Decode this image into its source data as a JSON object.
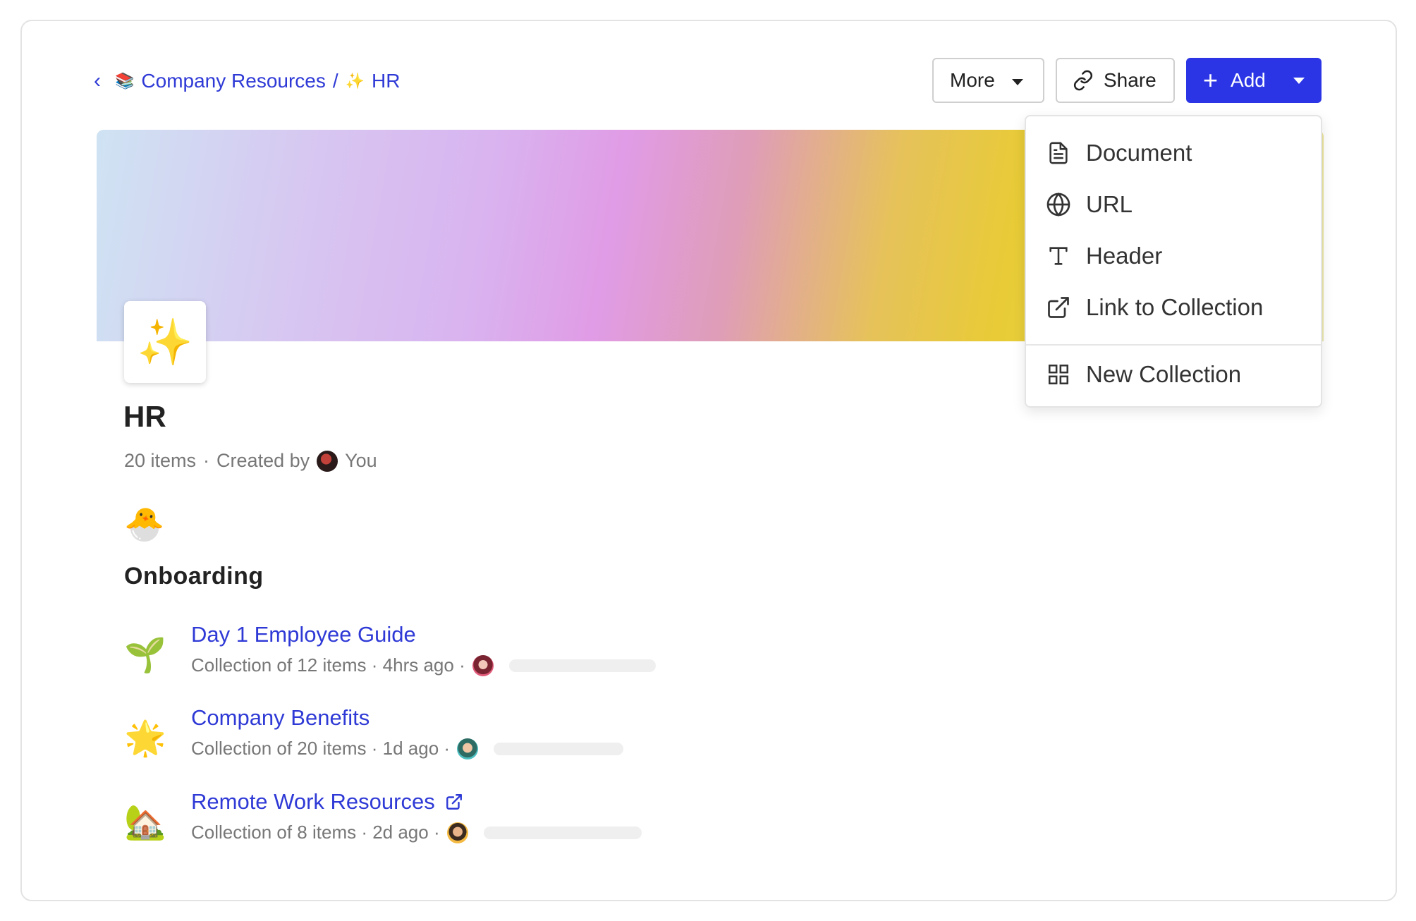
{
  "breadcrumb": {
    "back_icon": "chevron-left-icon",
    "parent_emoji": "📚",
    "parent_label": "Company Resources",
    "separator": "/",
    "current_emoji": "✨",
    "current_label": "HR"
  },
  "toolbar": {
    "more_label": "More",
    "share_label": "Share",
    "add_label": "Add",
    "add_color": "#2b35e6"
  },
  "collection": {
    "icon_emoji": "✨",
    "title": "HR",
    "item_count": "20 items",
    "dot": "·",
    "created_by_label": "Created by",
    "creator": "You"
  },
  "section": {
    "emoji": "🐣",
    "title": "Onboarding"
  },
  "items": [
    {
      "emoji": "🌱",
      "name": "Day 1 Employee Guide",
      "meta": "Collection of 12 items · 4hrs ago ·",
      "external": false
    },
    {
      "emoji": "🌟",
      "name": "Company Benefits",
      "meta": "Collection of 20 items · 1d ago ·",
      "external": false
    },
    {
      "emoji": "🏡",
      "name": "Remote Work Resources",
      "meta": "Collection of 8 items · 2d ago ·",
      "external": true
    }
  ],
  "add_menu": {
    "items": [
      {
        "label": "Document",
        "icon": "document-icon"
      },
      {
        "label": "URL",
        "icon": "globe-icon"
      },
      {
        "label": "Header",
        "icon": "text-icon"
      },
      {
        "label": "Link to Collection",
        "icon": "external-link-icon"
      },
      {
        "label": "New Collection",
        "icon": "grid-icon"
      }
    ]
  }
}
